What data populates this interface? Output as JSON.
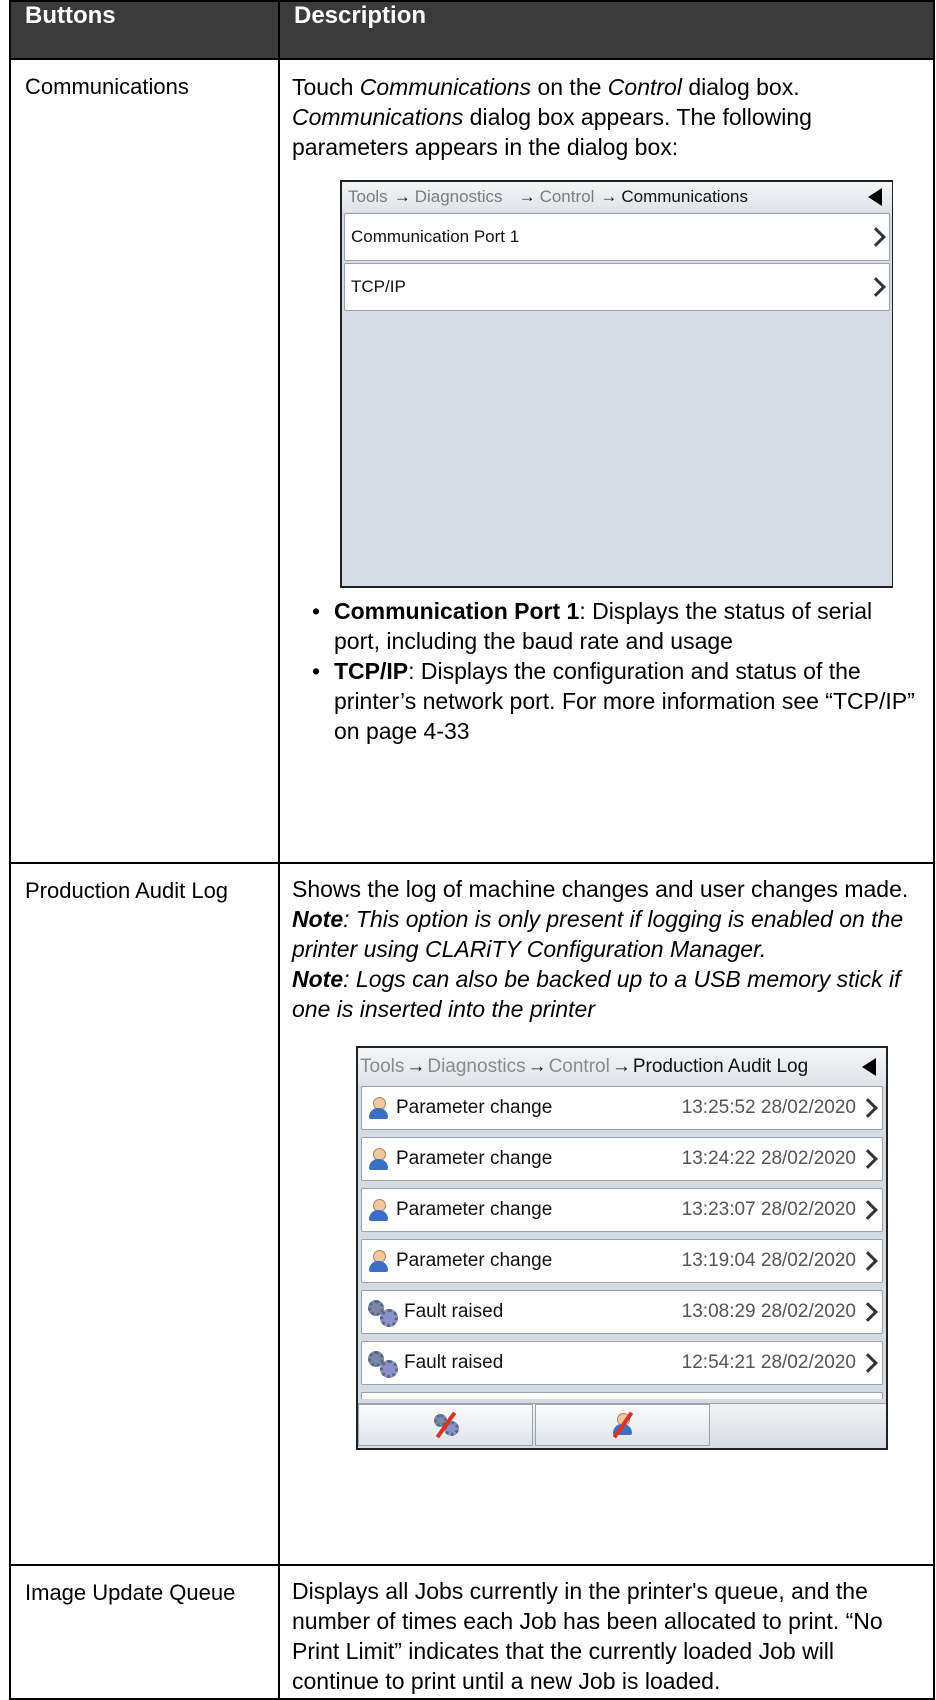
{
  "table": {
    "headers": [
      "Buttons",
      "Description"
    ]
  },
  "rows": {
    "communications": {
      "button": "Communications",
      "desc": {
        "p1": "Touch ",
        "p1_i1": "Communications",
        "p1_mid": " on the ",
        "p1_i2": "Control",
        "p1_end": " dialog box.",
        "p2_i": "Communications",
        "p2": " dialog box appears. The following parameters appears in the dialog box:"
      },
      "bullets": [
        {
          "term": "Communication Port 1",
          "text": ": Displays the status of serial port, including the baud rate and usage"
        },
        {
          "term": "TCP/IP",
          "text": ": Displays the configuration and status of the printer’s network port. For more information see “TCP/IP” on page 4-33"
        }
      ]
    },
    "audit": {
      "button": "Production Audit Log",
      "desc": "Shows the log of machine changes and user changes made.",
      "note1_label": "Note",
      "note1": ": This option is only present if logging is enabled on the printer using CLARiTY Configuration Manager.",
      "note2_label": "Note",
      "note2": ": Logs can also be backed up to a USB memory stick if one is inserted into the printer"
    },
    "queue": {
      "button": "Image Update Queue",
      "desc": "Displays all Jobs currently in the printer's queue, and the number of times each Job has been allocated to print. “No Print Limit” indicates that the currently loaded Job will continue to print until a new Job is loaded."
    }
  },
  "screen1": {
    "crumbs": [
      "Tools",
      "Diagnostics",
      "Control",
      "Communications"
    ],
    "items": [
      "Communication Port 1",
      "TCP/IP"
    ],
    "icons": {
      "back": "back-triangle-icon",
      "item": "chevron-right-icon"
    }
  },
  "screen2": {
    "crumbs": [
      "Tools",
      "Diagnostics",
      "Control",
      "Production Audit Log"
    ],
    "entries": [
      {
        "icon": "user-icon",
        "label": "Parameter change",
        "time": "13:25:52 28/02/2020"
      },
      {
        "icon": "user-icon",
        "label": "Parameter change",
        "time": "13:24:22 28/02/2020"
      },
      {
        "icon": "user-icon",
        "label": "Parameter change",
        "time": "13:23:07 28/02/2020"
      },
      {
        "icon": "user-icon",
        "label": "Parameter change",
        "time": "13:19:04 28/02/2020"
      },
      {
        "icon": "gears-icon",
        "label": "Fault raised",
        "time": "13:08:29 28/02/2020"
      },
      {
        "icon": "gears-icon",
        "label": "Fault raised",
        "time": "12:54:21 28/02/2020"
      }
    ],
    "toolbar": [
      "filter-faults-icon",
      "filter-user-icon"
    ]
  }
}
